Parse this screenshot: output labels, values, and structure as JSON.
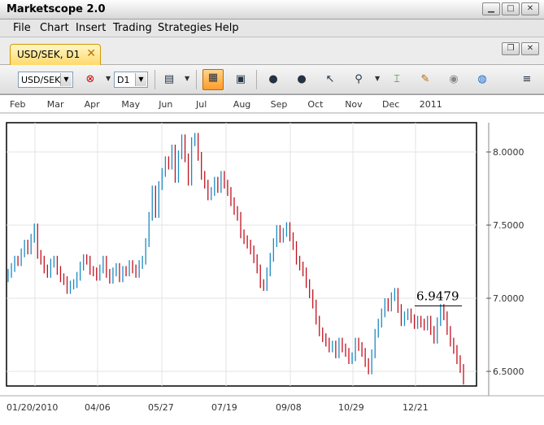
{
  "app": {
    "title": "Marketscope 2.0"
  },
  "menu": [
    "File",
    "Chart",
    "Insert",
    "Trading",
    "Strategies",
    "Help"
  ],
  "tab": {
    "label": "USD/SEK, D1"
  },
  "toolbar": {
    "instrument": "USD/SEK",
    "timeframe": "D1"
  },
  "chart_data": {
    "type": "bar",
    "symbol": "USD/SEK",
    "timeframe": "D1",
    "top_axis_labels": [
      "Feb",
      "Mar",
      "Apr",
      "May",
      "Jun",
      "Jul",
      "Aug",
      "Sep",
      "Oct",
      "Nov",
      "Dec",
      "2011"
    ],
    "bottom_axis_labels": [
      "01/20/2010",
      "04/06",
      "05/27",
      "07/19",
      "09/08",
      "10/29",
      "12/21"
    ],
    "y_tick_labels": [
      "8.0000",
      "7.5000",
      "7.0000",
      "6.5000"
    ],
    "y_ticks": [
      8.0,
      7.5,
      7.0,
      6.5
    ],
    "ylim": [
      6.4,
      8.2
    ],
    "annotation": {
      "text": "6.9479",
      "value": 6.9479
    },
    "closes": [
      7.17,
      7.21,
      7.26,
      7.25,
      7.31,
      7.37,
      7.33,
      7.41,
      7.48,
      7.3,
      7.26,
      7.2,
      7.17,
      7.24,
      7.26,
      7.19,
      7.14,
      7.12,
      7.06,
      7.09,
      7.1,
      7.15,
      7.22,
      7.27,
      7.26,
      7.19,
      7.18,
      7.15,
      7.2,
      7.26,
      7.17,
      7.13,
      7.18,
      7.21,
      7.14,
      7.19,
      7.18,
      7.23,
      7.2,
      7.17,
      7.23,
      7.26,
      7.38,
      7.56,
      7.74,
      7.58,
      7.77,
      7.86,
      7.94,
      7.91,
      8.02,
      7.82,
      7.98,
      8.09,
      7.96,
      7.8,
      8.07,
      8.1,
      7.97,
      7.84,
      7.78,
      7.7,
      7.73,
      7.8,
      7.75,
      7.84,
      7.78,
      7.73,
      7.66,
      7.6,
      7.56,
      7.44,
      7.4,
      7.37,
      7.33,
      7.27,
      7.2,
      7.1,
      7.08,
      7.18,
      7.28,
      7.38,
      7.47,
      7.41,
      7.45,
      7.49,
      7.42,
      7.36,
      7.26,
      7.22,
      7.18,
      7.1,
      7.03,
      6.96,
      6.85,
      6.77,
      6.73,
      6.7,
      6.66,
      6.68,
      6.62,
      6.7,
      6.66,
      6.63,
      6.58,
      6.6,
      6.7,
      6.67,
      6.63,
      6.56,
      6.51,
      6.62,
      6.76,
      6.83,
      6.9,
      6.97,
      6.94,
      7.01,
      7.04,
      6.93,
      6.84,
      6.88,
      6.9,
      6.86,
      6.82,
      6.85,
      6.83,
      6.81,
      6.85,
      6.78,
      6.72,
      6.84,
      6.93,
      6.88,
      6.78,
      6.7,
      6.65,
      6.58,
      6.52,
      6.44
    ]
  }
}
